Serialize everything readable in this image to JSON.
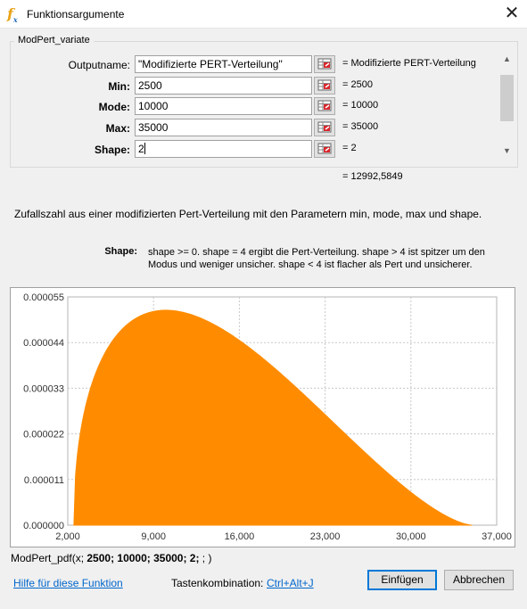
{
  "window": {
    "title": "Funktionsargumente"
  },
  "function": {
    "name": "ModPert_variate"
  },
  "arguments": [
    {
      "label": "Outputname:",
      "value": "\"Modifizierte PERT-Verteilung\"",
      "result": "= Modifizierte PERT-Verteilung"
    },
    {
      "label": "Min:",
      "value": "2500",
      "result": "= 2500"
    },
    {
      "label": "Mode:",
      "value": "10000",
      "result": "= 10000"
    },
    {
      "label": "Max:",
      "value": "35000",
      "result": "= 35000"
    },
    {
      "label": "Shape:",
      "value": "2",
      "result": "= 2"
    }
  ],
  "total_result": "= 12992,5849",
  "description": "Zufallszahl aus einer modifizierten Pert-Verteilung mit den Parametern min, mode, max und shape.",
  "param_help": {
    "name": "Shape:",
    "text": "shape >= 0. shape = 4 ergibt die Pert-Verteilung. shape > 4 ist spitzer um den Modus und weniger unsicher. shape < 4 ist flacher als Pert und unsicherer."
  },
  "formula": {
    "prefix": "ModPert_pdf(x; ",
    "args": "2500; 10000; 35000; 2;",
    "suffix": " ; )"
  },
  "footer": {
    "help_link": "Hilfe für diese Funktion",
    "shortcut_label": "Tastenkombination:",
    "shortcut_value": "Ctrl+Alt+J",
    "insert_button": "Einfügen",
    "cancel_button": "Abbrechen"
  },
  "colors": {
    "fill": "#ff8c00",
    "grid": "#c8c8c8",
    "accent": "#0078d7",
    "link": "#0066cc"
  },
  "chart_data": {
    "type": "area",
    "title": "",
    "xlabel": "",
    "ylabel": "",
    "xlim": [
      2000,
      37000
    ],
    "ylim": [
      0,
      5.5e-05
    ],
    "x_ticks": [
      "2,000",
      "9,000",
      "16,000",
      "23,000",
      "30,000",
      "37,000"
    ],
    "y_ticks": [
      "0.000000",
      "0.000011",
      "0.000022",
      "0.000033",
      "0.000044",
      "0.000055"
    ],
    "distribution": {
      "name": "ModPert",
      "min": 2500,
      "mode": 10000,
      "max": 35000,
      "shape": 2
    },
    "grid": true
  }
}
